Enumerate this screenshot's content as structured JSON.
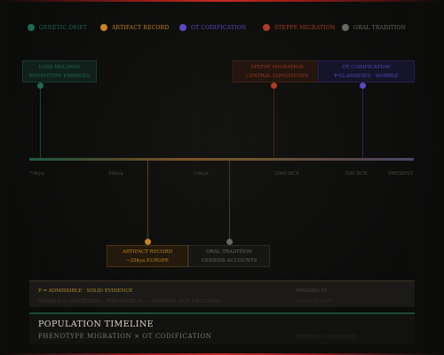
{
  "colors": {
    "green": "#1d6b50",
    "orange": "#c58622",
    "purple": "#5b49c4",
    "red": "#b03a25",
    "gray": "#6a6864",
    "gold": "#b8902a",
    "accent_red": "#c72a22"
  },
  "legend": [
    {
      "label": "GENETIC DRIFT",
      "color": "#1d6b50"
    },
    {
      "label": "ARTIFACT RECORD",
      "color": "#c58622"
    },
    {
      "label": "OT CODIFICATION",
      "color": "#5b49c4"
    },
    {
      "label": "STEPPE MIGRATION",
      "color": "#b03a25"
    },
    {
      "label": "ORAL TRADITION",
      "color": "#6a6864"
    }
  ],
  "events_above": [
    {
      "line1": "LOSS MELANIN",
      "line2": "PHENOTYPE EMERGES"
    },
    {
      "line1": "STEPPE MIGRATION",
      "line2": "CENTRAL LONGITUDES"
    },
    {
      "line1": "OT CODIFICATION",
      "line2": "P-CLASSIFIED · WOBBLE"
    }
  ],
  "events_below": [
    {
      "line1": "ARTIFACT RECORD",
      "line2": "~25kya EUROPE"
    },
    {
      "line1": "ORAL TRADITION",
      "line2": "GENESIS ACCOUNTS"
    }
  ],
  "axis": {
    "ticks": [
      "70kya",
      "40kya",
      "10kya",
      "3000 BCE",
      "500 BCE",
      "PRESENT"
    ]
  },
  "evidence": {
    "legend_line": "P = ADMISSIBLE · SOLID EVIDENCE",
    "wobble_line": "WOBBLE = CONTESTED · THEORETICAL — MARKED, NOT EXCLUDED",
    "finding": "FINDING 05",
    "search": "SEARCH 2026"
  },
  "title": {
    "main": "POPULATION TIMELINE",
    "sub": "PHENOTYPE MIGRATION × OT CODIFICATION",
    "right": "ADVRA PCL-2026 P-ACX"
  }
}
